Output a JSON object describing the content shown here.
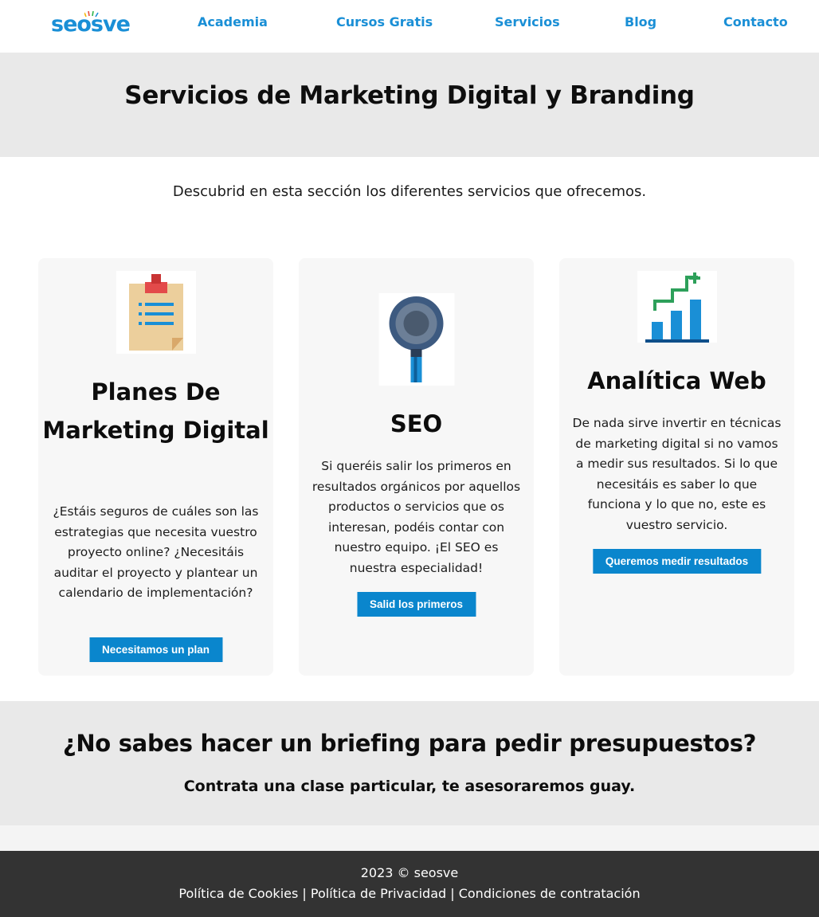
{
  "header": {
    "logo_text": "seosve",
    "nav": [
      "Academia",
      "Cursos Gratis",
      "Servicios",
      "Blog",
      "Contacto"
    ]
  },
  "hero": {
    "title": "Servicios de Marketing Digital y Branding"
  },
  "intro": "Descubrid en esta sección los diferentes servicios que ofrecemos.",
  "cards": [
    {
      "icon": "clipboard-list-icon",
      "title": "Planes De Marketing Digital",
      "text": "¿Estáis seguros de cuáles son las estrategias que necesita vuestro proyecto online? ¿Necesitáis auditar el proyecto y plantear un calendario de implementación?",
      "button": "Necesitamos un plan"
    },
    {
      "icon": "magnifying-glass-icon",
      "title": "SEO",
      "text": "Si queréis salir los primeros en resultados orgánicos por aquellos productos o servicios que os interesan, podéis contar con nuestro equipo. ¡El SEO es nuestra especialidad!",
      "button": "Salid los primeros"
    },
    {
      "icon": "bar-chart-growth-icon",
      "title": "Analítica Web",
      "text": "De nada sirve invertir en técnicas de marketing digital si no vamos a medir sus resultados. Si lo que necesitáis es saber lo que funciona y lo que no, este es vuestro servicio.",
      "button": "Queremos medir resultados"
    }
  ],
  "cta": {
    "title": "¿No sabes hacer un briefing para pedir presupuestos?",
    "subtitle": "Contrata una clase particular, te asesoraremos guay."
  },
  "footer": {
    "copyright": "2023 © seosve",
    "links": [
      "Política de Cookies",
      "Política de Privacidad",
      "Condiciones de contratación"
    ],
    "separator": " | "
  },
  "colors": {
    "brand_blue": "#1a8fd6",
    "button_blue": "#0a86cd",
    "footer_bg": "#333333",
    "band_bg": "#e9e9e9"
  }
}
